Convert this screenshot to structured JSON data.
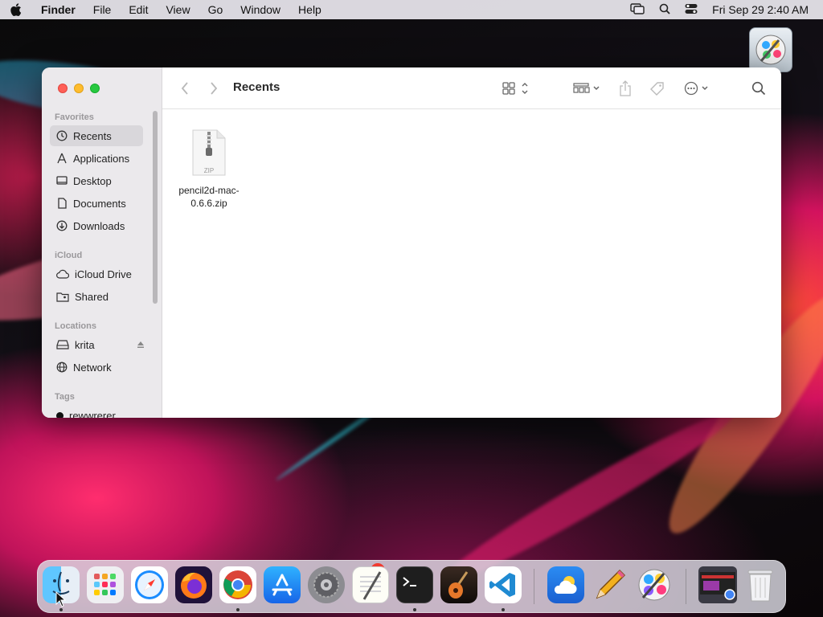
{
  "menubar": {
    "app_name": "Finder",
    "menus": [
      "File",
      "Edit",
      "View",
      "Go",
      "Window",
      "Help"
    ],
    "clock": "Fri Sep 29  2:40 AM"
  },
  "window": {
    "title": "Recents",
    "sidebar": {
      "favorites_header": "Favorites",
      "favorites": [
        "Recents",
        "Applications",
        "Desktop",
        "Documents",
        "Downloads"
      ],
      "icloud_header": "iCloud",
      "icloud": [
        "iCloud Drive",
        "Shared"
      ],
      "locations_header": "Locations",
      "locations": [
        "krita",
        "Network"
      ],
      "tags_header": "Tags",
      "tags": [
        "rewwrerer"
      ]
    },
    "files": [
      {
        "name": "pencil2d-mac-0.6.6.zip",
        "type_label": "ZIP"
      }
    ]
  },
  "dock": {
    "apps": [
      "Finder",
      "Launchpad",
      "Safari",
      "Firefox",
      "Chrome",
      "App Store",
      "System Preferences",
      "TextEdit",
      "Terminal",
      "GarageBand",
      "Visual Studio Code",
      "Weather",
      "Pencil2D",
      "Krita",
      "Screenshot",
      "Trash"
    ],
    "system_prefs_badge": "2"
  },
  "colors": {
    "close": "#ff5f57",
    "minimize": "#febc2e",
    "zoom": "#28c840",
    "sidebar_bg": "#ebe9ec",
    "selected_bg": "#d9d7db"
  }
}
